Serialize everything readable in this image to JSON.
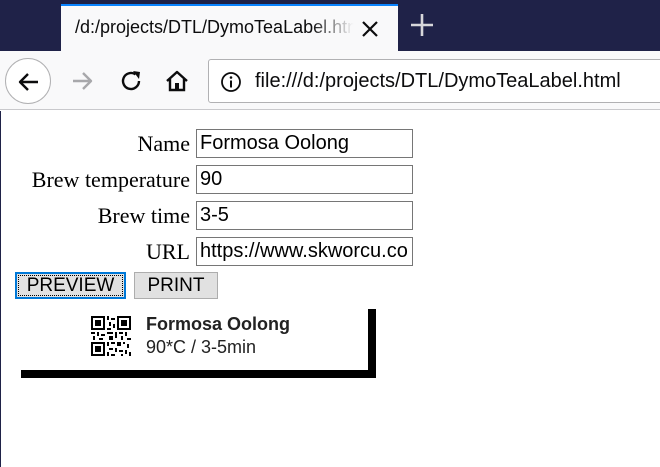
{
  "browser": {
    "tab": {
      "title": "/d:/projects/DTL/DymoTeaLabel.html"
    },
    "address_bar": {
      "url": "file:///d:/projects/DTL/DymoTeaLabel.html"
    },
    "icons": {
      "tab_close": "close-icon",
      "new_tab": "plus-icon",
      "back": "arrow-left-icon",
      "forward": "arrow-right-icon",
      "reload": "reload-icon",
      "home": "home-icon",
      "site_info": "info-icon"
    },
    "colors": {
      "tab_strip": "#1f2248",
      "active_tab_accent": "#0a84ff",
      "toolbar": "#f9f9fa"
    }
  },
  "form": {
    "name": {
      "label": "Name",
      "value": "Formosa Oolong"
    },
    "brew_temperature": {
      "label": "Brew temperature",
      "value": "90"
    },
    "brew_time": {
      "label": "Brew time",
      "value": "3-5"
    },
    "url": {
      "label": "URL",
      "value": "https://www.skworcu.co"
    },
    "buttons": {
      "preview": "PREVIEW",
      "print": "PRINT"
    }
  },
  "label_preview": {
    "title": "Formosa Oolong",
    "detail": "90*C / 3-5min",
    "qr_icon": "qr-code-icon"
  }
}
